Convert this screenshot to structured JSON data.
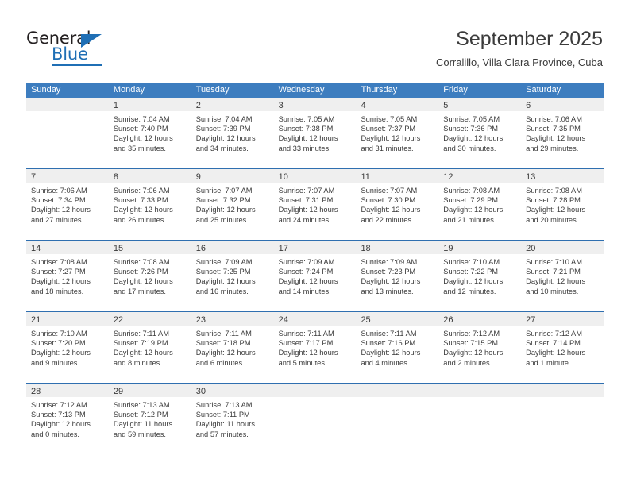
{
  "brand": {
    "name_dark": "General",
    "name_blue": "Blue",
    "accent_color": "#1f6fb5"
  },
  "header": {
    "title": "September 2025",
    "subtitle": "Corralillo, Villa Clara Province, Cuba"
  },
  "calendar": {
    "header_bg": "#3d7dbf",
    "band_bg": "#efefef",
    "week_separator_color": "#2f6fb0",
    "weekdays": [
      "Sunday",
      "Monday",
      "Tuesday",
      "Wednesday",
      "Thursday",
      "Friday",
      "Saturday"
    ],
    "weeks": [
      [
        {
          "day": "",
          "empty": true,
          "sunrise": "",
          "sunset": "",
          "daylight_line1": "",
          "daylight_line2": ""
        },
        {
          "day": "1",
          "empty": false,
          "sunrise": "Sunrise: 7:04 AM",
          "sunset": "Sunset: 7:40 PM",
          "daylight_line1": "Daylight: 12 hours",
          "daylight_line2": "and 35 minutes."
        },
        {
          "day": "2",
          "empty": false,
          "sunrise": "Sunrise: 7:04 AM",
          "sunset": "Sunset: 7:39 PM",
          "daylight_line1": "Daylight: 12 hours",
          "daylight_line2": "and 34 minutes."
        },
        {
          "day": "3",
          "empty": false,
          "sunrise": "Sunrise: 7:05 AM",
          "sunset": "Sunset: 7:38 PM",
          "daylight_line1": "Daylight: 12 hours",
          "daylight_line2": "and 33 minutes."
        },
        {
          "day": "4",
          "empty": false,
          "sunrise": "Sunrise: 7:05 AM",
          "sunset": "Sunset: 7:37 PM",
          "daylight_line1": "Daylight: 12 hours",
          "daylight_line2": "and 31 minutes."
        },
        {
          "day": "5",
          "empty": false,
          "sunrise": "Sunrise: 7:05 AM",
          "sunset": "Sunset: 7:36 PM",
          "daylight_line1": "Daylight: 12 hours",
          "daylight_line2": "and 30 minutes."
        },
        {
          "day": "6",
          "empty": false,
          "sunrise": "Sunrise: 7:06 AM",
          "sunset": "Sunset: 7:35 PM",
          "daylight_line1": "Daylight: 12 hours",
          "daylight_line2": "and 29 minutes."
        }
      ],
      [
        {
          "day": "7",
          "empty": false,
          "sunrise": "Sunrise: 7:06 AM",
          "sunset": "Sunset: 7:34 PM",
          "daylight_line1": "Daylight: 12 hours",
          "daylight_line2": "and 27 minutes."
        },
        {
          "day": "8",
          "empty": false,
          "sunrise": "Sunrise: 7:06 AM",
          "sunset": "Sunset: 7:33 PM",
          "daylight_line1": "Daylight: 12 hours",
          "daylight_line2": "and 26 minutes."
        },
        {
          "day": "9",
          "empty": false,
          "sunrise": "Sunrise: 7:07 AM",
          "sunset": "Sunset: 7:32 PM",
          "daylight_line1": "Daylight: 12 hours",
          "daylight_line2": "and 25 minutes."
        },
        {
          "day": "10",
          "empty": false,
          "sunrise": "Sunrise: 7:07 AM",
          "sunset": "Sunset: 7:31 PM",
          "daylight_line1": "Daylight: 12 hours",
          "daylight_line2": "and 24 minutes."
        },
        {
          "day": "11",
          "empty": false,
          "sunrise": "Sunrise: 7:07 AM",
          "sunset": "Sunset: 7:30 PM",
          "daylight_line1": "Daylight: 12 hours",
          "daylight_line2": "and 22 minutes."
        },
        {
          "day": "12",
          "empty": false,
          "sunrise": "Sunrise: 7:08 AM",
          "sunset": "Sunset: 7:29 PM",
          "daylight_line1": "Daylight: 12 hours",
          "daylight_line2": "and 21 minutes."
        },
        {
          "day": "13",
          "empty": false,
          "sunrise": "Sunrise: 7:08 AM",
          "sunset": "Sunset: 7:28 PM",
          "daylight_line1": "Daylight: 12 hours",
          "daylight_line2": "and 20 minutes."
        }
      ],
      [
        {
          "day": "14",
          "empty": false,
          "sunrise": "Sunrise: 7:08 AM",
          "sunset": "Sunset: 7:27 PM",
          "daylight_line1": "Daylight: 12 hours",
          "daylight_line2": "and 18 minutes."
        },
        {
          "day": "15",
          "empty": false,
          "sunrise": "Sunrise: 7:08 AM",
          "sunset": "Sunset: 7:26 PM",
          "daylight_line1": "Daylight: 12 hours",
          "daylight_line2": "and 17 minutes."
        },
        {
          "day": "16",
          "empty": false,
          "sunrise": "Sunrise: 7:09 AM",
          "sunset": "Sunset: 7:25 PM",
          "daylight_line1": "Daylight: 12 hours",
          "daylight_line2": "and 16 minutes."
        },
        {
          "day": "17",
          "empty": false,
          "sunrise": "Sunrise: 7:09 AM",
          "sunset": "Sunset: 7:24 PM",
          "daylight_line1": "Daylight: 12 hours",
          "daylight_line2": "and 14 minutes."
        },
        {
          "day": "18",
          "empty": false,
          "sunrise": "Sunrise: 7:09 AM",
          "sunset": "Sunset: 7:23 PM",
          "daylight_line1": "Daylight: 12 hours",
          "daylight_line2": "and 13 minutes."
        },
        {
          "day": "19",
          "empty": false,
          "sunrise": "Sunrise: 7:10 AM",
          "sunset": "Sunset: 7:22 PM",
          "daylight_line1": "Daylight: 12 hours",
          "daylight_line2": "and 12 minutes."
        },
        {
          "day": "20",
          "empty": false,
          "sunrise": "Sunrise: 7:10 AM",
          "sunset": "Sunset: 7:21 PM",
          "daylight_line1": "Daylight: 12 hours",
          "daylight_line2": "and 10 minutes."
        }
      ],
      [
        {
          "day": "21",
          "empty": false,
          "sunrise": "Sunrise: 7:10 AM",
          "sunset": "Sunset: 7:20 PM",
          "daylight_line1": "Daylight: 12 hours",
          "daylight_line2": "and 9 minutes."
        },
        {
          "day": "22",
          "empty": false,
          "sunrise": "Sunrise: 7:11 AM",
          "sunset": "Sunset: 7:19 PM",
          "daylight_line1": "Daylight: 12 hours",
          "daylight_line2": "and 8 minutes."
        },
        {
          "day": "23",
          "empty": false,
          "sunrise": "Sunrise: 7:11 AM",
          "sunset": "Sunset: 7:18 PM",
          "daylight_line1": "Daylight: 12 hours",
          "daylight_line2": "and 6 minutes."
        },
        {
          "day": "24",
          "empty": false,
          "sunrise": "Sunrise: 7:11 AM",
          "sunset": "Sunset: 7:17 PM",
          "daylight_line1": "Daylight: 12 hours",
          "daylight_line2": "and 5 minutes."
        },
        {
          "day": "25",
          "empty": false,
          "sunrise": "Sunrise: 7:11 AM",
          "sunset": "Sunset: 7:16 PM",
          "daylight_line1": "Daylight: 12 hours",
          "daylight_line2": "and 4 minutes."
        },
        {
          "day": "26",
          "empty": false,
          "sunrise": "Sunrise: 7:12 AM",
          "sunset": "Sunset: 7:15 PM",
          "daylight_line1": "Daylight: 12 hours",
          "daylight_line2": "and 2 minutes."
        },
        {
          "day": "27",
          "empty": false,
          "sunrise": "Sunrise: 7:12 AM",
          "sunset": "Sunset: 7:14 PM",
          "daylight_line1": "Daylight: 12 hours",
          "daylight_line2": "and 1 minute."
        }
      ],
      [
        {
          "day": "28",
          "empty": false,
          "sunrise": "Sunrise: 7:12 AM",
          "sunset": "Sunset: 7:13 PM",
          "daylight_line1": "Daylight: 12 hours",
          "daylight_line2": "and 0 minutes."
        },
        {
          "day": "29",
          "empty": false,
          "sunrise": "Sunrise: 7:13 AM",
          "sunset": "Sunset: 7:12 PM",
          "daylight_line1": "Daylight: 11 hours",
          "daylight_line2": "and 59 minutes."
        },
        {
          "day": "30",
          "empty": false,
          "sunrise": "Sunrise: 7:13 AM",
          "sunset": "Sunset: 7:11 PM",
          "daylight_line1": "Daylight: 11 hours",
          "daylight_line2": "and 57 minutes."
        },
        {
          "day": "",
          "empty": true,
          "sunrise": "",
          "sunset": "",
          "daylight_line1": "",
          "daylight_line2": ""
        },
        {
          "day": "",
          "empty": true,
          "sunrise": "",
          "sunset": "",
          "daylight_line1": "",
          "daylight_line2": ""
        },
        {
          "day": "",
          "empty": true,
          "sunrise": "",
          "sunset": "",
          "daylight_line1": "",
          "daylight_line2": ""
        },
        {
          "day": "",
          "empty": true,
          "sunrise": "",
          "sunset": "",
          "daylight_line1": "",
          "daylight_line2": ""
        }
      ]
    ]
  }
}
